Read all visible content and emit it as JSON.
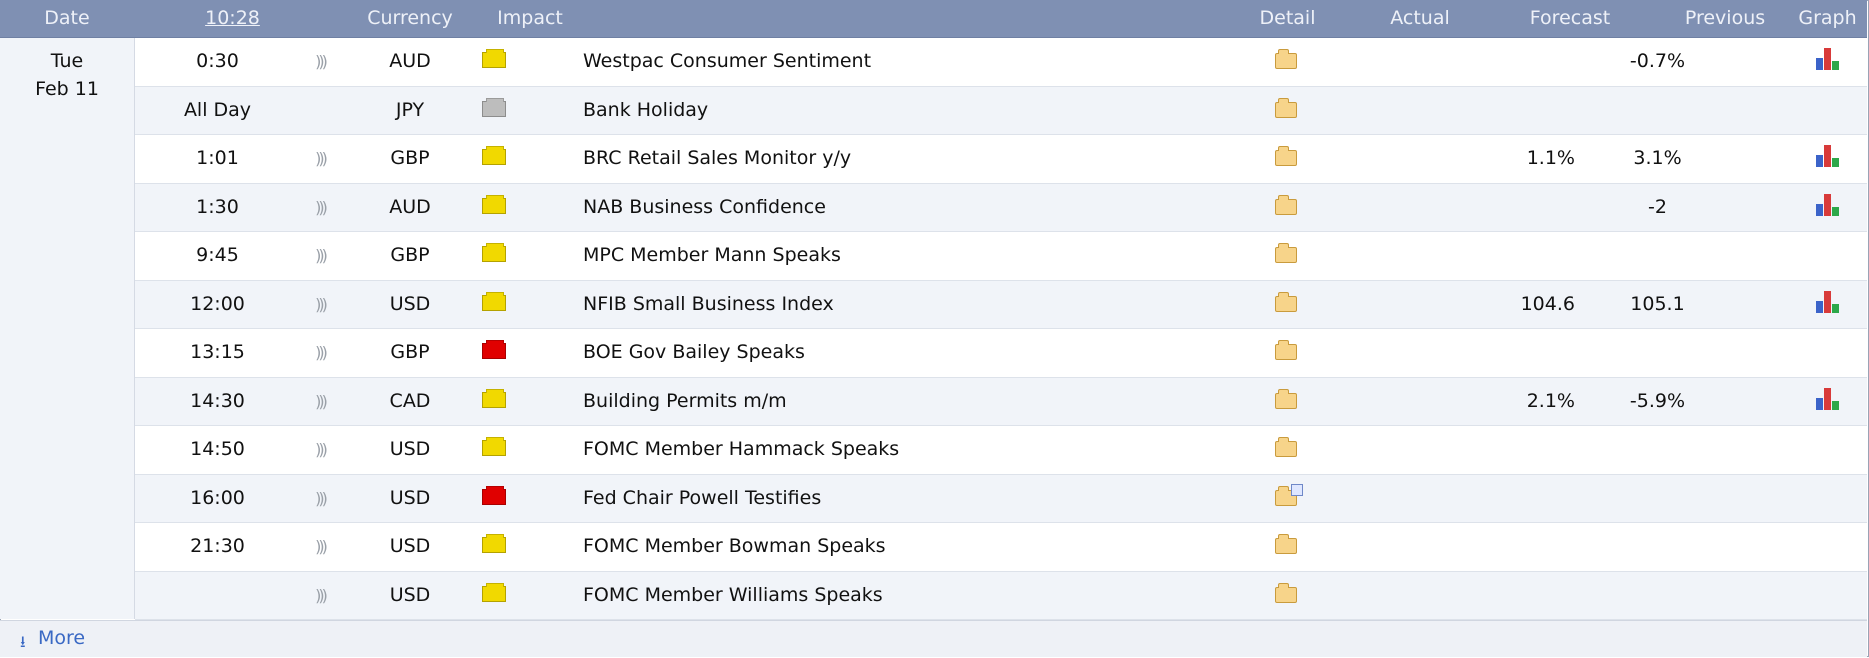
{
  "header": {
    "date": "Date",
    "time": "10:28",
    "currency": "Currency",
    "impact": "Impact",
    "detail": "Detail",
    "actual": "Actual",
    "forecast": "Forecast",
    "previous": "Previous",
    "graph": "Graph"
  },
  "date": {
    "day": "Tue",
    "month_day": "Feb 11"
  },
  "colors": {
    "header_bg": "#7f90b3",
    "impact_medium": "#f1d900",
    "impact_high": "#e00000",
    "impact_low": "#bdbdbd",
    "link": "#3a69c4"
  },
  "icons": {
    "alarm": "alarm-icon",
    "impact": "impact-folder-icon",
    "detail": "detail-folder-icon",
    "graph": "bar-graph-icon",
    "more": "down-arrow-icon"
  },
  "events": [
    {
      "time": "0:30",
      "alarm": ")))",
      "currency": "AUD",
      "impact": "medium",
      "event": "Westpac Consumer Sentiment",
      "actual": "",
      "forecast": "",
      "previous": "-0.7%",
      "graph": true
    },
    {
      "time": "All Day",
      "alarm": "",
      "currency": "JPY",
      "impact": "low",
      "event": "Bank Holiday",
      "actual": "",
      "forecast": "",
      "previous": "",
      "graph": false
    },
    {
      "time": "1:01",
      "alarm": ")))",
      "currency": "GBP",
      "impact": "medium",
      "event": "BRC Retail Sales Monitor y/y",
      "actual": "",
      "forecast": "1.1%",
      "previous": "3.1%",
      "graph": true
    },
    {
      "time": "1:30",
      "alarm": ")))",
      "currency": "AUD",
      "impact": "medium",
      "event": "NAB Business Confidence",
      "actual": "",
      "forecast": "",
      "previous": "-2",
      "graph": true
    },
    {
      "time": "9:45",
      "alarm": ")))",
      "currency": "GBP",
      "impact": "medium",
      "event": "MPC Member Mann Speaks",
      "actual": "",
      "forecast": "",
      "previous": "",
      "graph": false
    },
    {
      "time": "12:00",
      "alarm": ")))",
      "currency": "USD",
      "impact": "medium",
      "event": "NFIB Small Business Index",
      "actual": "",
      "forecast": "104.6",
      "previous": "105.1",
      "graph": true
    },
    {
      "time": "13:15",
      "alarm": ")))",
      "currency": "GBP",
      "impact": "high",
      "event": "BOE Gov Bailey Speaks",
      "actual": "",
      "forecast": "",
      "previous": "",
      "graph": false
    },
    {
      "time": "14:30",
      "alarm": ")))",
      "currency": "CAD",
      "impact": "medium",
      "event": "Building Permits m/m",
      "actual": "",
      "forecast": "2.1%",
      "previous": "-5.9%",
      "graph": true
    },
    {
      "time": "14:50",
      "alarm": ")))",
      "currency": "USD",
      "impact": "medium",
      "event": "FOMC Member Hammack Speaks",
      "actual": "",
      "forecast": "",
      "previous": "",
      "graph": false
    },
    {
      "time": "16:00",
      "alarm": ")))",
      "currency": "USD",
      "impact": "high",
      "event": "Fed Chair Powell Testifies",
      "actual": "",
      "forecast": "",
      "previous": "",
      "graph": false,
      "detail_open": true
    },
    {
      "time": "21:30",
      "alarm": ")))",
      "currency": "USD",
      "impact": "medium",
      "event": "FOMC Member Bowman Speaks",
      "actual": "",
      "forecast": "",
      "previous": "",
      "graph": false
    },
    {
      "time": "",
      "alarm": ")))",
      "currency": "USD",
      "impact": "medium",
      "event": "FOMC Member Williams Speaks",
      "actual": "",
      "forecast": "",
      "previous": "",
      "graph": false
    }
  ],
  "more": {
    "icon": "⭳",
    "label": "More"
  }
}
